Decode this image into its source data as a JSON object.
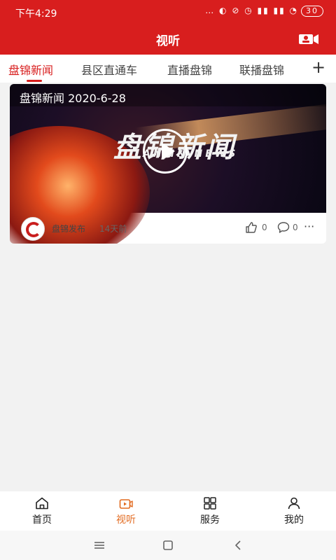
{
  "status_bar": {
    "time": "下午4:29",
    "icons": "… ◐ ⊘ ◷ ▮▮ ▮▮ ◔",
    "battery": "30"
  },
  "header": {
    "title": "视听",
    "camera_icon": "video-camera-icon"
  },
  "tabs": [
    {
      "label": "盘锦新闻",
      "active": true
    },
    {
      "label": "县区直通车",
      "active": false
    },
    {
      "label": "直播盘锦",
      "active": false
    },
    {
      "label": "联播盘锦",
      "active": false
    }
  ],
  "tab_add_icon": "+",
  "video_card": {
    "caption": "盘锦新闻 2020-6-28",
    "logo_text": "盘锦新闻",
    "logo_sub": "ANJIN NEWS",
    "source": "盘锦发布",
    "time_ago": "14天前",
    "likes": "0",
    "comments": "0",
    "more": "···"
  },
  "bottom_nav": [
    {
      "label": "首页",
      "icon": "home-icon",
      "active": false
    },
    {
      "label": "视听",
      "icon": "video-icon",
      "active": true
    },
    {
      "label": "服务",
      "icon": "grid-icon",
      "active": false
    },
    {
      "label": "我的",
      "icon": "user-icon",
      "active": false
    }
  ],
  "system_nav": {
    "menu_icon": "menu-icon",
    "home_icon": "square-icon",
    "back_icon": "back-icon"
  },
  "colors": {
    "brand_red": "#d81e1e",
    "active_nav": "#e26a1f"
  }
}
